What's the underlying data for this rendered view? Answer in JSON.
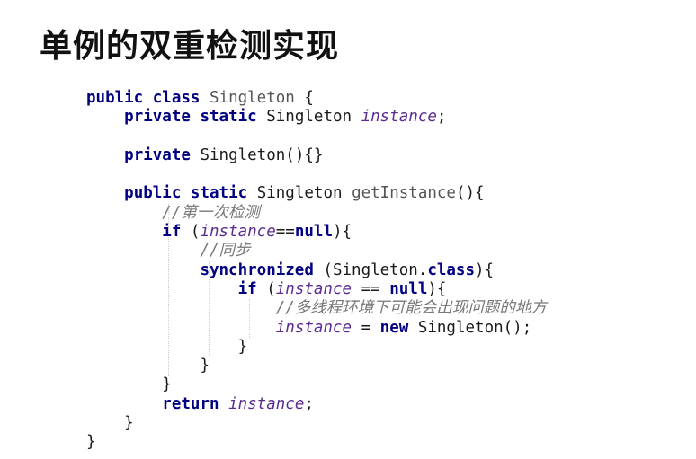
{
  "title": "单例的双重检测实现",
  "code": {
    "l1": {
      "kw1": "public",
      "kw2": "class",
      "name": "Singleton",
      "brace": "{"
    },
    "l2": {
      "kw1": "private",
      "kw2": "static",
      "type": "Singleton",
      "field": "instance",
      "end": ";"
    },
    "l4": {
      "kw1": "private",
      "text": "Singleton(){}"
    },
    "l6": {
      "kw1": "public",
      "kw2": "static",
      "type": "Singleton",
      "method": "getInstance",
      "end": "(){"
    },
    "l7": {
      "comment": "//第一次检测"
    },
    "l8": {
      "kw": "if",
      "open": "(",
      "field": "instance",
      "op": "==",
      "null": "null",
      "close": "){"
    },
    "l9": {
      "comment": "//同步"
    },
    "l10": {
      "kw": "synchronized",
      "mid": "(Singleton.",
      "kw2": "class",
      "close": "){"
    },
    "l11": {
      "kw": "if",
      "open": "(",
      "field": "instance",
      "op": "==",
      "null": "null",
      "close": "){"
    },
    "l12": {
      "comment": "//多线程环境下可能会出现问题的地方"
    },
    "l13": {
      "field": "instance",
      "eq": "=",
      "kw": "new",
      "rest": "Singleton();"
    },
    "l14": {
      "brace": "}"
    },
    "l15": {
      "brace": "}"
    },
    "l16": {
      "brace": "}"
    },
    "l17": {
      "kw": "return",
      "field": "instance",
      "end": ";"
    },
    "l18": {
      "brace": "}"
    },
    "l19": {
      "brace": "}"
    }
  }
}
